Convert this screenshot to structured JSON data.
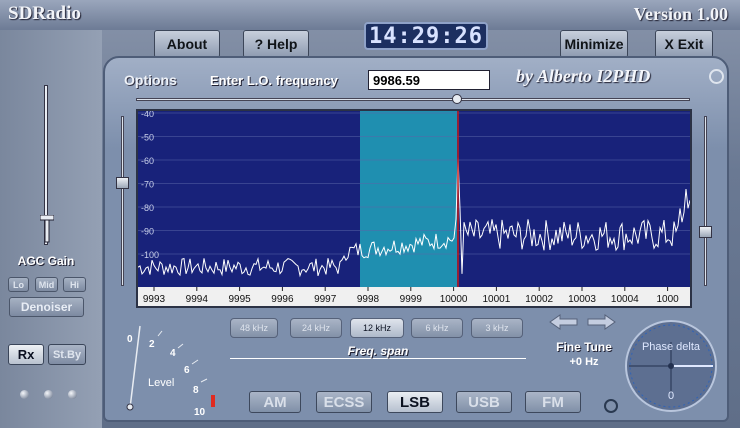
{
  "window": {
    "title": "SDRadio",
    "version": "Version 1.00"
  },
  "toolbar": {
    "about": "About",
    "help": "? Help",
    "clock": "14:29:26",
    "minimize": "Minimize",
    "exit": "X Exit"
  },
  "options": {
    "label": "Options",
    "lo_label": "Enter L.O. frequency",
    "lo_value": "9986.59",
    "author": "by Alberto I2PHD"
  },
  "agc": {
    "label": "AGC Gain",
    "lo": "Lo",
    "mid": "Mid",
    "hi": "Hi",
    "denoiser": "Denoiser",
    "rx": "Rx",
    "standby": "St.By"
  },
  "spectrum": {
    "y_ticks": [
      "-40",
      "-50",
      "-60",
      "-70",
      "-80",
      "-90",
      "-100"
    ],
    "x_ticks": [
      "9993",
      "9994",
      "9995",
      "9996",
      "9997",
      "9998",
      "9999",
      "10000",
      "10001",
      "10002",
      "10003",
      "10004",
      "1000"
    ],
    "colors": {
      "background": "#18227a",
      "passband": "#1f8fb0",
      "trace": "#ffffff",
      "grid": "#5a66a8",
      "marker": "#c02020"
    }
  },
  "span": {
    "buttons": [
      "48 kHz",
      "24 kHz",
      "12 kHz",
      "6 kHz",
      "3 kHz"
    ],
    "selected": "12 kHz",
    "label": "Freq. span"
  },
  "fine_tune": {
    "label": "Fine Tune",
    "value": "+0 Hz"
  },
  "modes": {
    "buttons": [
      "AM",
      "ECSS",
      "LSB",
      "USB",
      "FM"
    ],
    "selected": "LSB"
  },
  "level": {
    "label": "Level",
    "ticks": [
      "0",
      "2",
      "4",
      "6",
      "8",
      "10"
    ]
  },
  "phase": {
    "label": "Phase delta",
    "value": "0"
  }
}
